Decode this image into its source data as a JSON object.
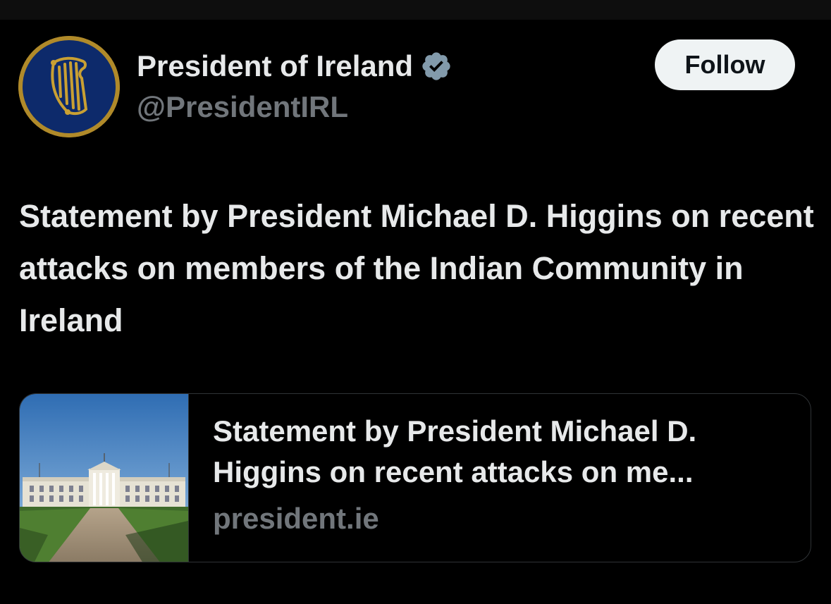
{
  "account": {
    "display_name": "President of Ireland",
    "handle": "@PresidentIRL",
    "verified": true,
    "avatar_icon": "irish-harp-seal-icon"
  },
  "actions": {
    "follow_label": "Follow"
  },
  "post": {
    "text": "Statement by President Michael D. Higgins on recent attacks on members of the Indian Community in Ireland"
  },
  "link_card": {
    "title": "Statement by President Michael D. Higgins on recent attacks on me...",
    "domain": "president.ie",
    "thumbnail": "aras-an-uachtarain-building-photo"
  },
  "colors": {
    "background": "#000000",
    "text_primary": "#e7e9ea",
    "text_secondary": "#71767b",
    "follow_button_bg": "#eff3f4",
    "verified_badge": "#829aab",
    "seal_blue": "#0d2a6b",
    "seal_gold": "#c9a033"
  }
}
